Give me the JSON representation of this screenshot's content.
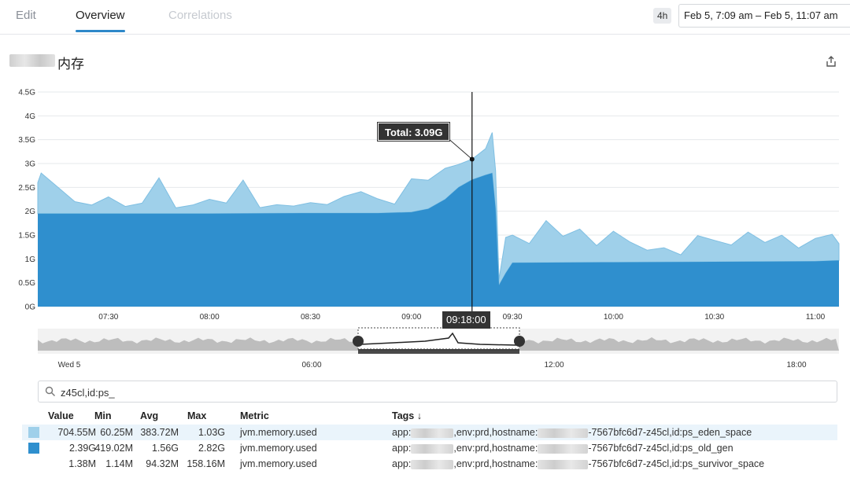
{
  "header": {
    "tabs": [
      {
        "label": "Edit"
      },
      {
        "label": "Overview"
      },
      {
        "label": "Correlations"
      }
    ],
    "span_badge": "4h",
    "time_range": "Feb 5, 7:09 am – Feb 5, 11:07 am"
  },
  "widget": {
    "title": "内存",
    "share_icon": "share-icon"
  },
  "tooltip": {
    "total": "Total: 3.09G",
    "time": "09:18:00"
  },
  "search": {
    "value": "z45cl,id:ps_",
    "icon": "search-icon"
  },
  "colors": {
    "eden": "#9fd0ea",
    "old_gen": "#2f8fce",
    "accent": "#2e88c9"
  },
  "chart_data": {
    "type": "area",
    "stacked": true,
    "y_ticks": [
      "0G",
      "0.5G",
      "1G",
      "1.5G",
      "2G",
      "2.5G",
      "3G",
      "3.5G",
      "4G",
      "4.5G"
    ],
    "ylim": [
      0,
      4.5
    ],
    "y_unit": "G",
    "x_ticks": [
      "07:30",
      "08:00",
      "08:30",
      "09:00",
      "09:30",
      "10:00",
      "10:30",
      "11:00"
    ],
    "x_range": [
      "07:09",
      "11:07"
    ],
    "grid": true,
    "crosshair": "09:18",
    "series": [
      {
        "metric": "ps_old_gen",
        "x": [
          "07:09",
          "07:30",
          "08:00",
          "08:30",
          "08:50",
          "09:00",
          "09:05",
          "09:10",
          "09:14",
          "09:18",
          "09:22",
          "09:24",
          "09:25",
          "09:26",
          "09:28",
          "09:30",
          "10:00",
          "10:30",
          "11:00",
          "11:07"
        ],
        "values": [
          1.95,
          1.95,
          1.95,
          1.96,
          1.96,
          1.98,
          2.05,
          2.25,
          2.5,
          2.66,
          2.76,
          2.8,
          2.05,
          0.45,
          0.7,
          0.92,
          0.93,
          0.94,
          0.95,
          0.97
        ]
      },
      {
        "metric": "ps_eden_space",
        "x": [
          "07:09",
          "07:10",
          "07:15",
          "07:20",
          "07:25",
          "07:30",
          "07:35",
          "07:40",
          "07:45",
          "07:50",
          "07:55",
          "08:00",
          "08:05",
          "08:10",
          "08:15",
          "08:20",
          "08:25",
          "08:30",
          "08:35",
          "08:40",
          "08:45",
          "08:50",
          "08:55",
          "09:00",
          "09:05",
          "09:10",
          "09:14",
          "09:18",
          "09:22",
          "09:24",
          "09:25",
          "09:26",
          "09:28",
          "09:30",
          "09:35",
          "09:40",
          "09:45",
          "09:50",
          "09:55",
          "10:00",
          "10:05",
          "10:10",
          "10:15",
          "10:20",
          "10:25",
          "10:30",
          "10:35",
          "10:40",
          "10:45",
          "10:50",
          "10:55",
          "11:00",
          "11:05",
          "11:07"
        ],
        "values": [
          0.65,
          0.85,
          0.55,
          0.25,
          0.18,
          0.35,
          0.15,
          0.22,
          0.75,
          0.12,
          0.18,
          0.3,
          0.22,
          0.7,
          0.12,
          0.18,
          0.15,
          0.22,
          0.18,
          0.35,
          0.45,
          0.3,
          0.18,
          0.7,
          0.6,
          0.65,
          0.48,
          0.43,
          0.55,
          0.85,
          0.8,
          0.12,
          0.75,
          0.58,
          0.4,
          0.88,
          0.55,
          0.7,
          0.35,
          0.65,
          0.42,
          0.25,
          0.3,
          0.15,
          0.55,
          0.45,
          0.35,
          0.62,
          0.4,
          0.55,
          0.28,
          0.48,
          0.55,
          0.35
        ]
      }
    ],
    "navigator": {
      "x_ticks": [
        "Wed 5",
        "06:00",
        "12:00",
        "18:00"
      ],
      "selection": [
        "07:09",
        "11:07"
      ]
    },
    "table": {
      "columns": [
        "Value",
        "Min",
        "Avg",
        "Max",
        "Metric",
        "Tags ↓"
      ],
      "rows": [
        {
          "value": "704.55M",
          "min": "60.25M",
          "avg": "383.72M",
          "max": "1.03G",
          "metric": "jvm.memory.used",
          "tags_prefix": "app:",
          "tags_mid": ",env:prd,hostname:",
          "tags_suffix": "-7567bfc6d7-z45cl,id:ps_eden_space",
          "color": "#9fd0ea"
        },
        {
          "value": "2.39G",
          "min": "419.02M",
          "avg": "1.56G",
          "max": "2.82G",
          "metric": "jvm.memory.used",
          "tags_prefix": "app:",
          "tags_mid": ",env:prd,hostname:",
          "tags_suffix": "-7567bfc6d7-z45cl,id:ps_old_gen",
          "color": "#2f8fce"
        },
        {
          "value": "1.38M",
          "min": "1.14M",
          "avg": "94.32M",
          "max": "158.16M",
          "metric": "jvm.memory.used",
          "tags_prefix": "app:",
          "tags_mid": ",env:prd,hostname:",
          "tags_suffix": "-7567bfc6d7-z45cl,id:ps_survivor_space",
          "color": "#ffffff"
        }
      ]
    }
  }
}
